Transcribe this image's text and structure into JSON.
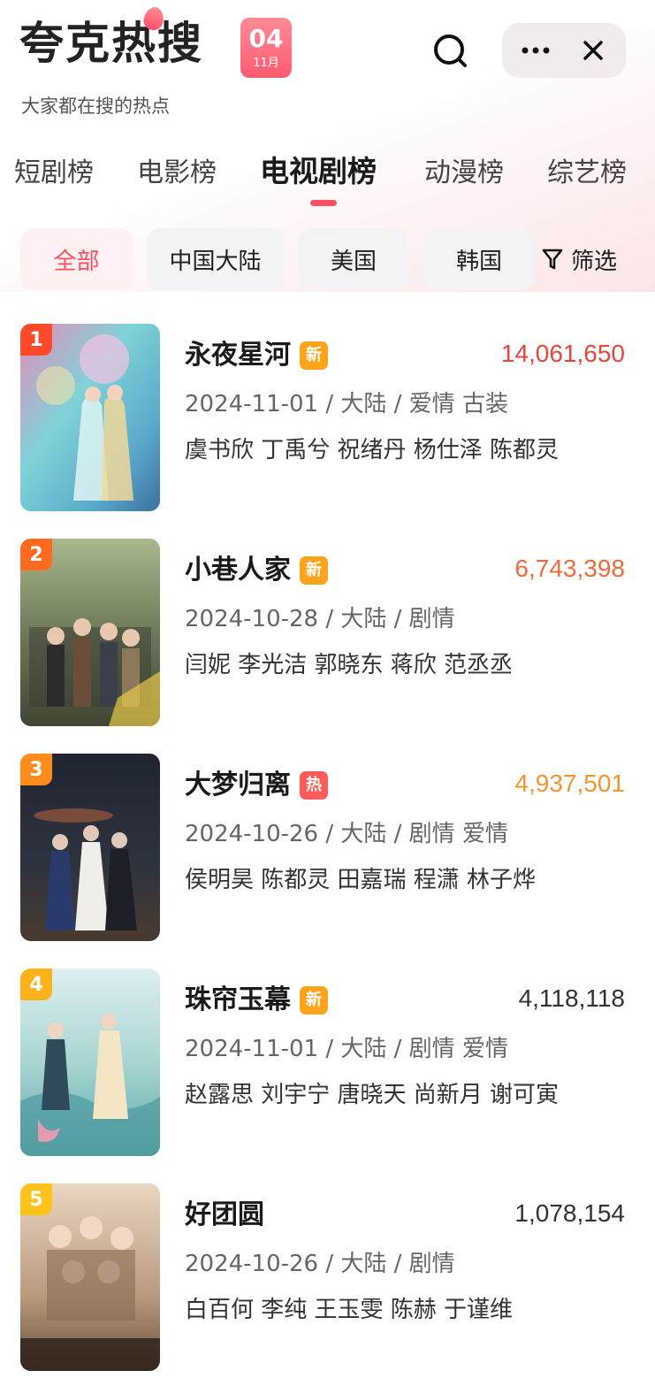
{
  "header": {
    "brand_title": "夸克热搜",
    "date_day": "04",
    "date_month": "11月",
    "slogan": "大家都在搜的热点"
  },
  "tabs": [
    {
      "label": "短剧榜"
    },
    {
      "label": "电影榜"
    },
    {
      "label": "电视剧榜",
      "active": true
    },
    {
      "label": "动漫榜"
    },
    {
      "label": "综艺榜"
    }
  ],
  "filters": {
    "chips": [
      {
        "label": "全部",
        "active": true
      },
      {
        "label": "中国大陆"
      },
      {
        "label": "美国"
      },
      {
        "label": "韩国"
      }
    ],
    "filter_label": "筛选"
  },
  "colors": {
    "accent": "#ff4f62",
    "rank1": "#ff4a2a",
    "rank2": "#ff6a1f",
    "rank3": "#ff8c1a",
    "rank4": "#ffb11a",
    "rank5": "#ffc21a",
    "tag_new": "#ffa31a",
    "tag_hot": "#ff5a5a"
  },
  "items": [
    {
      "rank": "1",
      "title": "永夜星河",
      "tag": "新",
      "tag_type": "new",
      "heat": "14,061,650",
      "heat_color": "#e8453c",
      "meta": "2024-11-01 / 大陆 / 爱情  古装",
      "cast": "虞书欣  丁禹兮  祝绪丹  杨仕泽  陈都灵"
    },
    {
      "rank": "2",
      "title": "小巷人家",
      "tag": "新",
      "tag_type": "new",
      "heat": "6,743,398",
      "heat_color": "#ef6b3a",
      "meta": "2024-10-28 / 大陆 / 剧情",
      "cast": "闫妮  李光洁  郭晓东  蒋欣  范丞丞"
    },
    {
      "rank": "3",
      "title": "大梦归离",
      "tag": "热",
      "tag_type": "hot",
      "heat": "4,937,501",
      "heat_color": "#f4962c",
      "meta": "2024-10-26 / 大陆 / 剧情  爱情",
      "cast": "侯明昊  陈都灵  田嘉瑞  程潇  林子烨"
    },
    {
      "rank": "4",
      "title": "珠帘玉幕",
      "tag": "新",
      "tag_type": "new",
      "heat": "4,118,118",
      "heat_color": "#333333",
      "meta": "2024-11-01 / 大陆 / 剧情  爱情",
      "cast": "赵露思  刘宇宁  唐晓天  尚新月  谢可寅"
    },
    {
      "rank": "5",
      "title": "好团圆",
      "tag": "",
      "tag_type": "",
      "heat": "1,078,154",
      "heat_color": "#333333",
      "meta": "2024-10-26 / 大陆 / 剧情",
      "cast": "白百何  李纯  王玉雯  陈赫  于谨维"
    }
  ]
}
